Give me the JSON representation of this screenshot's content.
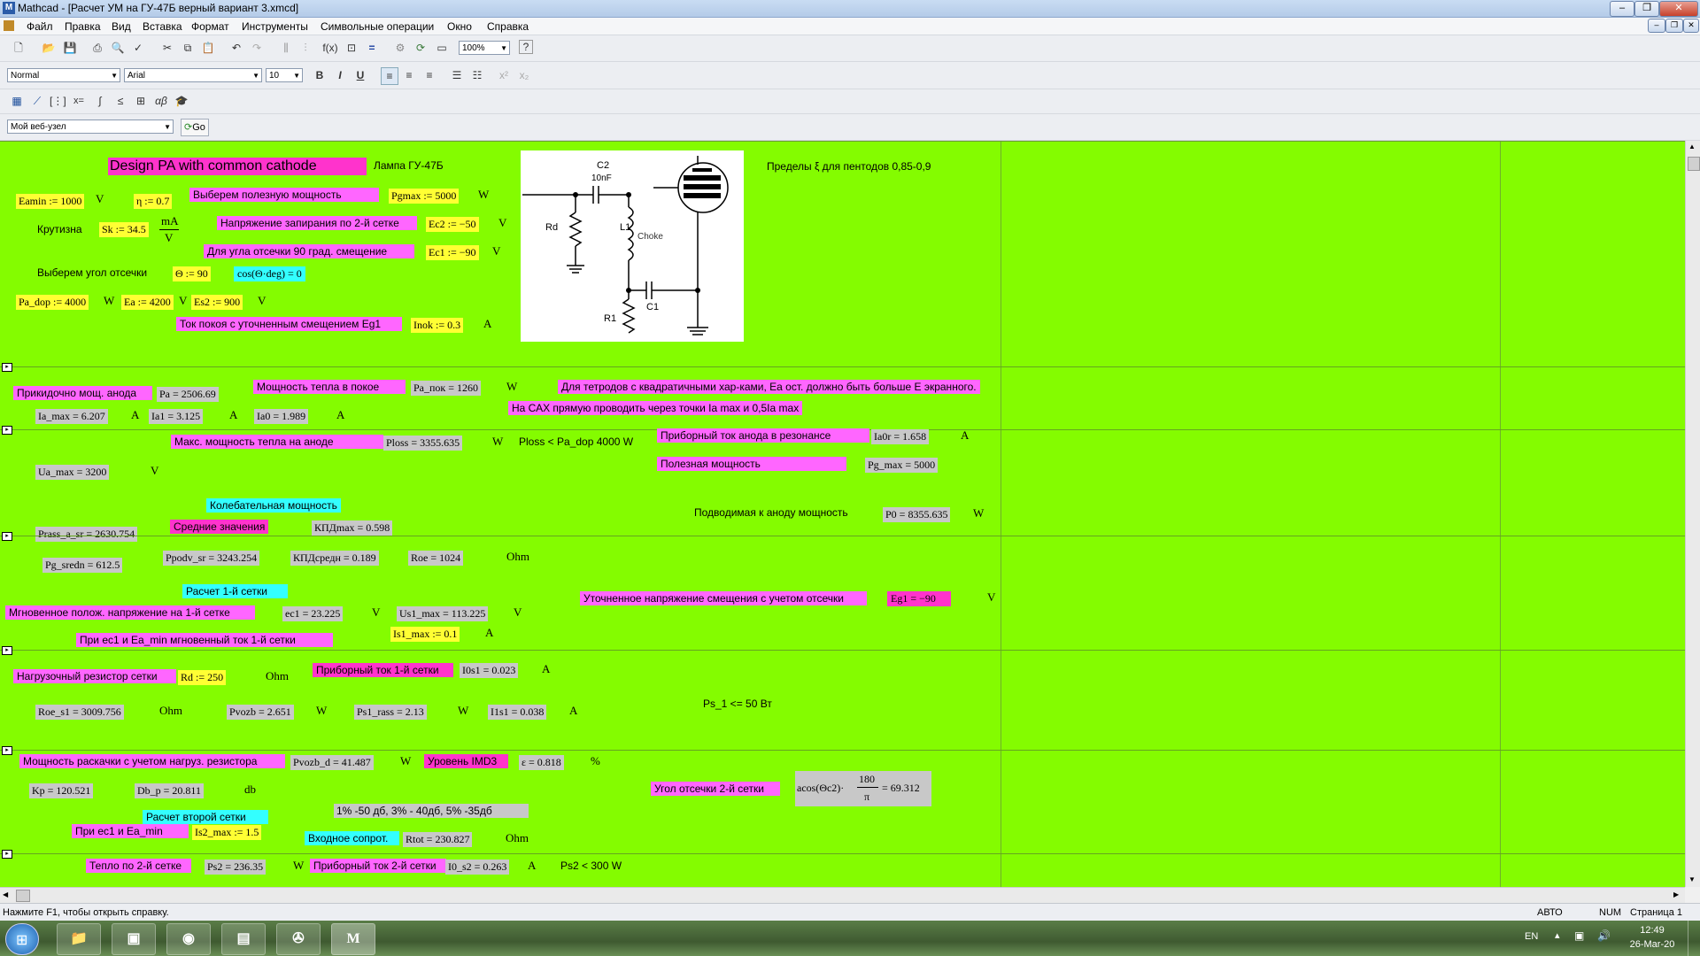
{
  "window": {
    "title": "Mathcad - [Расчет УМ на ГУ-47Б  верный вариант 3.xmcd]",
    "app_icon": "M"
  },
  "menu": [
    "Файл",
    "Правка",
    "Вид",
    "Вставка",
    "Формат",
    "Инструменты",
    "Символьные операции",
    "Окно",
    "Справка"
  ],
  "format_toolbar": {
    "style": "Normal",
    "font": "Arial",
    "size": "10",
    "zoom": "100%"
  },
  "web_toolbar": {
    "address": "Мой веб-узел",
    "go_label": "Go"
  },
  "sheet": {
    "title": "Design PA with common cathode",
    "lamp": "Лампа ГУ-47Б",
    "limits": "Пределы ξ для пентодов  0,85-0,9",
    "diagram": {
      "c2": "C2",
      "c2_val": "10nF",
      "rd": "Rd",
      "l1": "L1",
      "choke": "Choke",
      "r1": "R1",
      "c1": "C1"
    },
    "s1": {
      "eamin": "Eamin := 1000",
      "eamin_u": "V",
      "eta": "η := 0.7",
      "pgmax_lbl": "Выберем полезную мощность",
      "pgmax": "Pgmax := 5000",
      "pgmax_u": "W",
      "krut": "Крутизна",
      "sk": "Sk := 34.5",
      "sk_u_top": "mA",
      "sk_u_bot": "V",
      "ec2_lbl": "Напряжение запирания по 2-й сетке",
      "ec2": "Ec2 := −50",
      "ec2_u": "V",
      "ec1_lbl": "Для угла отсечки 90 град. смещение",
      "ec1": "Ec1 := −90",
      "ec1_u": "V",
      "theta_lbl": "Выберем угол отсечки",
      "theta": "Θ := 90",
      "cos": "cos(Θ·deg) = 0",
      "padop": "Pa_dop := 4000",
      "padop_u": "W",
      "ea": "Ea := 4200",
      "ea_u": "V",
      "es2": "Es2 := 900",
      "es2_u": "V",
      "inok_lbl": "Ток покоя с уточненным смещением Eg1",
      "inok": "Inok := 0.3",
      "inok_u": "A"
    },
    "s2": {
      "pa_lbl": "Прикидочно мощ. анода",
      "pa": "Pa = 2506.69",
      "papok_lbl": "Мощность тепла в покое",
      "papok": "Pa_пок = 1260",
      "papok_u": "W",
      "tetr": "Для тетродов с квадратичными хар-ками, Еа ост. должно быть больше Е экранного.",
      "cax": "На САХ прямую проводить через точки Ia max  и 0,5Ia max",
      "iamax": "Ia_max = 6.207",
      "iamax_u": "A",
      "ia1": "Ia1 = 3.125",
      "ia1_u": "A",
      "ia0": "Ia0 = 1.989",
      "ia0_u": "A"
    },
    "s3": {
      "ploss_lbl": "Макс. мощность тепла на аноде",
      "ploss": "Ploss = 3355.635",
      "ploss_u": "W",
      "ploss_cmp": "Ploss < Pa_dop 4000 W",
      "ia0r_lbl": "Приборный ток анода  в резонансе",
      "ia0r": "Ia0r = 1.658",
      "ia0r_u": "A",
      "pgmax_lbl": "Полезная мощность",
      "pgmax": "Pg_max = 5000",
      "uamax": "Ua_max = 3200",
      "uamax_u": "V",
      "kol": "Колебательная мощность",
      "p0_lbl": "Подводимая к аноду мощность",
      "p0": "P0 = 8355.635",
      "p0_u": "W",
      "sred": "Средние значения",
      "kpdmax": "КПДmax = 0.598",
      "prass": "Prass_a_sr = 2630.754"
    },
    "s4": {
      "pgsredn": "Pg_sredn = 612.5",
      "ppodv": "Ppodv_sr = 3243.254",
      "kpdsr": "КПДсредн = 0.189",
      "roe": "Roe = 1024",
      "roe_u": "Ohm",
      "rasch1": "Расчет 1-й сетки",
      "eg1_lbl": "Уточненное напряжение смещения с учетом отсечки",
      "eg1": "Eg1 = −90",
      "eg1_u": "V",
      "mgn_lbl": "Мгновенное полож. напряжение на 1-й сетке",
      "ec1": "ec1 = 23.225",
      "ec1_u": "V",
      "us1": "Us1_max = 113.225",
      "us1_u": "V",
      "is1_lbl": "При ec1  и Ea_min мгновенный ток 1-й сетки",
      "is1": "Is1_max := 0.1",
      "is1_u": "A"
    },
    "s5": {
      "rd_lbl": "Нагрузочный резистор сетки",
      "rd": "Rd := 250",
      "rd_u": "Ohm",
      "i0s1_lbl": "Приборный ток 1-й сетки",
      "i0s1": "I0s1 = 0.023",
      "i0s1_u": "A",
      "roes1": "Roe_s1 = 3009.756",
      "roes1_u": "Ohm",
      "pvozb": "Pvozb = 2.651",
      "pvozb_u": "W",
      "ps1": "Ps1_rass = 2.13",
      "ps1_u": "W",
      "i1s1": "I1s1 = 0.038",
      "i1s1_u": "A",
      "ps1cmp": "Ps_1 <= 50 Вт"
    },
    "s6": {
      "mr_lbl": "Мощность раскачки с учетом нагруз. резистора",
      "pvozbd": "Pvozb_d = 41.487",
      "pvozbd_u": "W",
      "imd_lbl": "Уровень IMD3",
      "eps": "ε = 0.818",
      "eps_u": "%",
      "kp": "Kp = 120.521",
      "dbp": "Db_p = 20.811",
      "dbp_u": "db",
      "ugol_lbl": "Угол отсечки 2-й сетки",
      "acos_a": "acos(Θc2)·",
      "acos_top": "180",
      "acos_bot": "π",
      "acos_res": "= 69.312",
      "rasch2": "Расчет второй сетки",
      "imdtab": "1% -50 дб, 3% - 40дб, 5% -35дб",
      "ec1ea": "При ec1 и Ea_min",
      "is2": "Is2_max := 1.5",
      "vhod": "Входное сопрот.",
      "rtot": "Rtot = 230.827",
      "rtot_u": "Ohm"
    },
    "s7": {
      "teplo_lbl": "Тепло по 2-й сетке",
      "ps2": "Ps2 = 236.35",
      "ps2_u": "W",
      "i0s2_lbl": "Приборный ток 2-й сетки",
      "i0s2": "I0_s2 = 0.263",
      "i0s2_u": "A",
      "ps2cmp": "Ps2 < 300 W"
    }
  },
  "status": {
    "help": "Нажмите F1, чтобы открыть справку.",
    "mode": "АВТО",
    "num": "NUM",
    "page": "Страница 1"
  },
  "taskbar": {
    "lang": "EN",
    "time": "12:49",
    "date": "26-Mar-20"
  }
}
